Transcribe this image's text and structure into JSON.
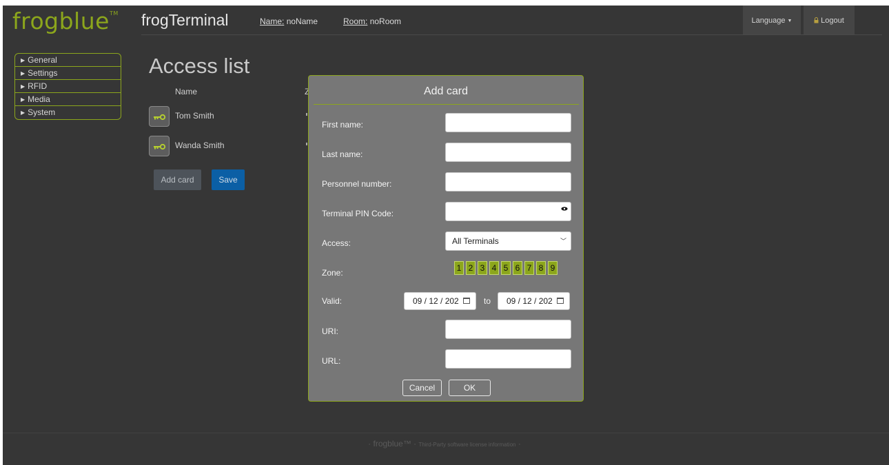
{
  "brand": {
    "logo_text": "frogblue",
    "logo_tm": "TM",
    "app_title": "frogTerminal"
  },
  "header": {
    "name_key": "Name:",
    "name_value": "noName",
    "room_key": "Room:",
    "room_value": "noRoom",
    "language_label": "Language",
    "logout_label": "Logout"
  },
  "sidebar": {
    "items": [
      {
        "label": "General"
      },
      {
        "label": "Settings"
      },
      {
        "label": "RFID"
      },
      {
        "label": "Media"
      },
      {
        "label": "System"
      }
    ]
  },
  "main": {
    "title": "Access list",
    "col_name": "Name",
    "col_zone": "Z",
    "rows": [
      {
        "name": "Tom Smith"
      },
      {
        "name": "Wanda Smith"
      }
    ],
    "add_card_label": "Add card",
    "save_label": "Save"
  },
  "dialog": {
    "title": "Add card",
    "first_name_label": "First name:",
    "first_name_value": "",
    "last_name_label": "Last name:",
    "last_name_value": "",
    "personnel_label": "Personnel number:",
    "personnel_value": "",
    "pin_label": "Terminal PIN Code:",
    "pin_value": "",
    "access_label": "Access:",
    "access_value": "All Terminals",
    "zone_label": "Zone:",
    "zones": [
      "1",
      "2",
      "3",
      "4",
      "5",
      "6",
      "7",
      "8",
      "9"
    ],
    "valid_label": "Valid:",
    "valid_from": "09 / 12 / 202",
    "valid_to_label": "to",
    "valid_to": "09 / 12 / 202",
    "uri_label": "URI:",
    "uri_value": "",
    "url_label": "URL:",
    "url_value": "",
    "cancel_label": "Cancel",
    "ok_label": "OK"
  },
  "footer": {
    "brand": "· frogblue™ ·",
    "license": "Third-Party software license information",
    "end": "·"
  },
  "colors": {
    "accent": "#8ca61c",
    "background": "#363636",
    "dialog": "#777777",
    "save_button": "#0b5fa5"
  }
}
